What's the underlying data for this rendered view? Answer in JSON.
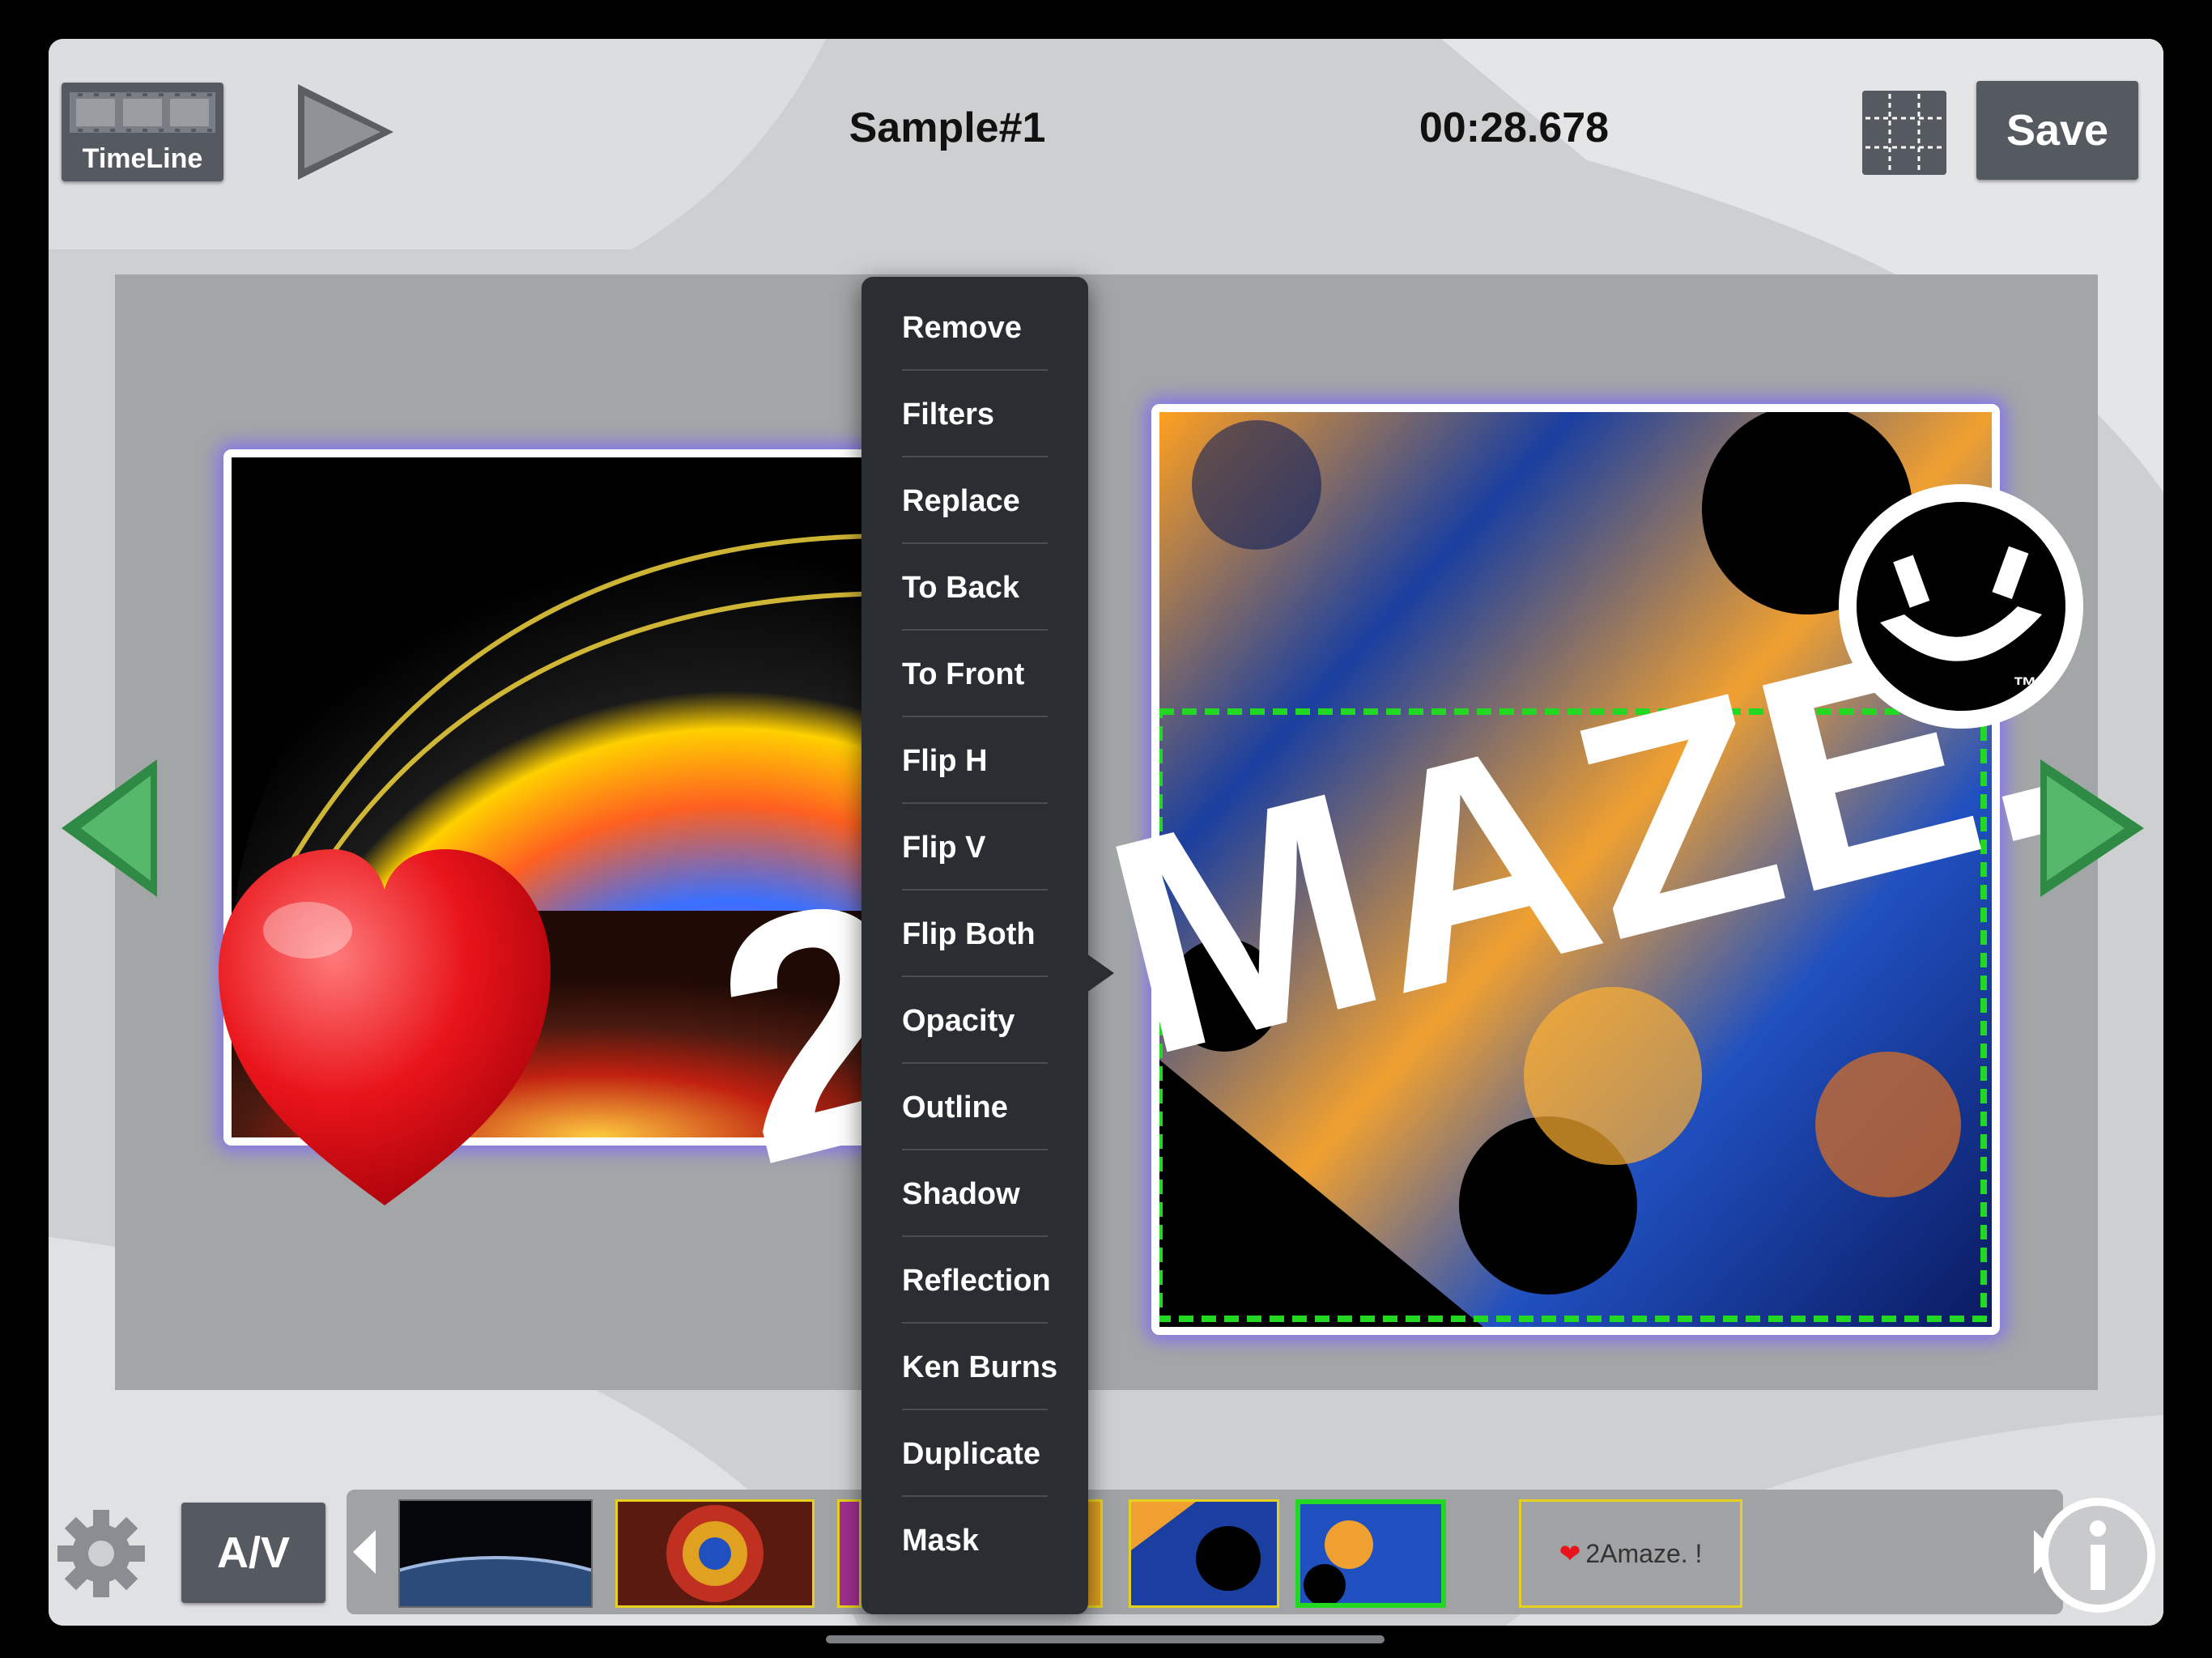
{
  "toolbar": {
    "timeline_label": "TimeLine",
    "project_title": "Sample#1",
    "timecode": "00:28.678",
    "save_label": "Save"
  },
  "context_menu": {
    "items": [
      "Remove",
      "Filters",
      "Replace",
      "To Back",
      "To Front",
      "Flip H",
      "Flip V",
      "Flip Both",
      "Opacity",
      "Outline",
      "Shadow",
      "Reflection",
      "Ken Burns",
      "Duplicate",
      "Mask"
    ]
  },
  "canvas": {
    "logo_left_text": "2/",
    "logo_right_text": "MAZE.",
    "trademark": "™"
  },
  "bottom_bar": {
    "av_label": "A/V",
    "text_clip_label": "2Amaze. !"
  },
  "colors": {
    "button_bg": "#555a60",
    "canvas_bg": "#a3a6a7",
    "menu_bg": "#2a2d31",
    "nav_arrow": "#3a9a52",
    "selected_clip": "#22d822",
    "text_clip_border": "#e6d21e",
    "photo_glow": "#7864ff"
  },
  "icons": {
    "play": "play-icon",
    "grid": "grid-icon",
    "prev": "arrow-left-icon",
    "next": "arrow-right-icon",
    "settings": "gear-icon",
    "info": "info-icon"
  }
}
